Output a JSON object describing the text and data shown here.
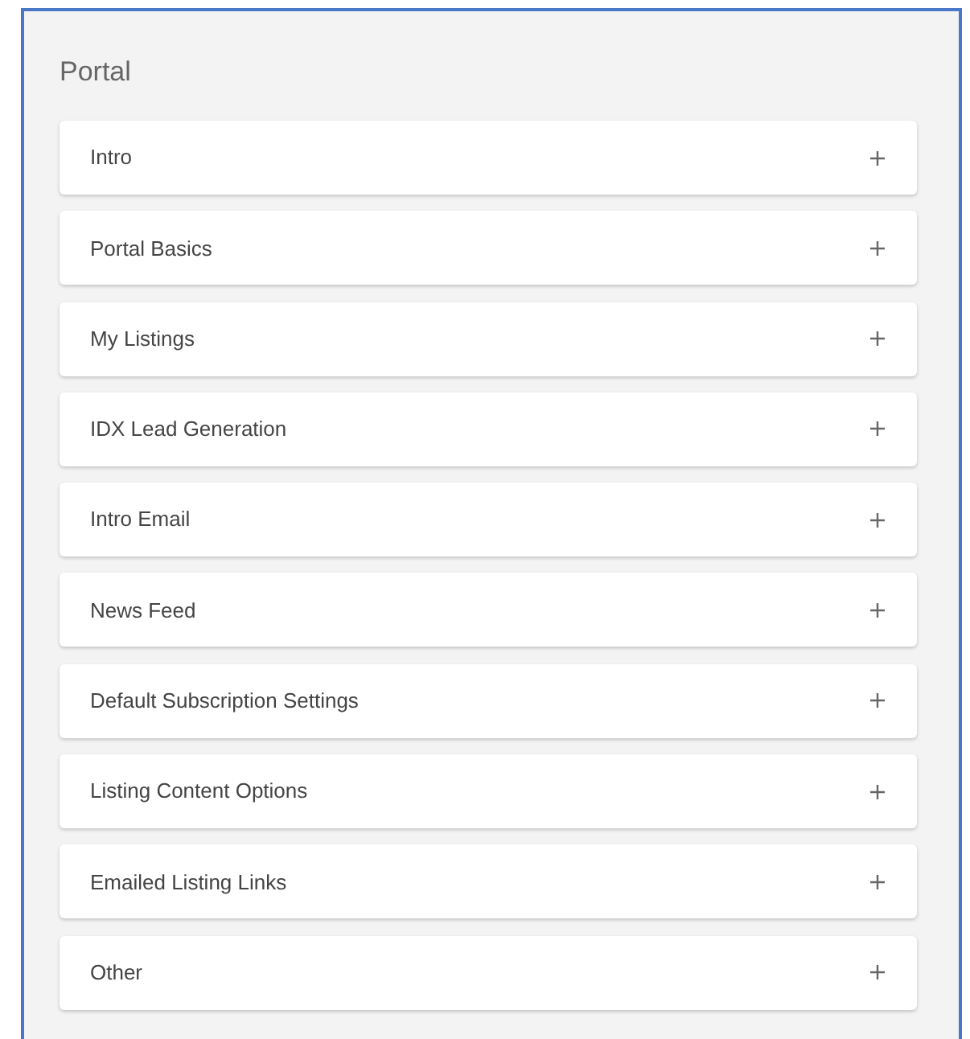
{
  "panel": {
    "title": "Portal"
  },
  "sections": [
    {
      "label": "Intro",
      "expanded": false
    },
    {
      "label": "Portal Basics",
      "expanded": false
    },
    {
      "label": "My Listings",
      "expanded": false
    },
    {
      "label": "IDX Lead Generation",
      "expanded": false
    },
    {
      "label": "Intro Email",
      "expanded": false
    },
    {
      "label": "News Feed",
      "expanded": false
    },
    {
      "label": "Default Subscription Settings",
      "expanded": false
    },
    {
      "label": "Listing Content Options",
      "expanded": false
    },
    {
      "label": "Emailed Listing Links",
      "expanded": false
    },
    {
      "label": "Other",
      "expanded": false
    }
  ]
}
